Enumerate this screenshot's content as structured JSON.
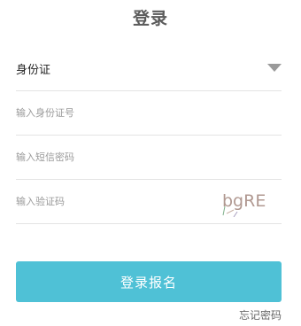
{
  "header": {
    "title": "登录"
  },
  "form": {
    "id_type": {
      "selected": "身份证"
    },
    "id_number": {
      "placeholder": "输入身份证号",
      "value": ""
    },
    "sms_code": {
      "placeholder": "输入短信密码",
      "value": ""
    },
    "captcha": {
      "placeholder": "输入验证码",
      "value": "",
      "image_text": "bgRE"
    }
  },
  "actions": {
    "submit_label": "登录报名",
    "forgot_label": "忘记密码"
  },
  "colors": {
    "accent": "#4fc1d6",
    "captcha_text": "#b09890"
  }
}
